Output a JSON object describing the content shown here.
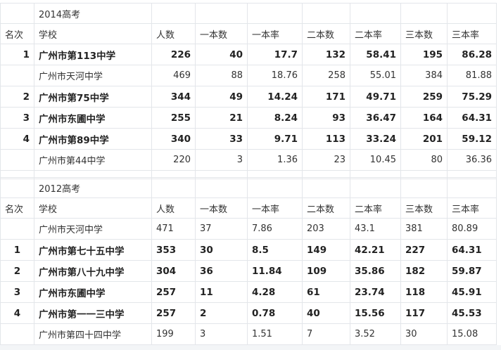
{
  "headers": [
    "名次",
    "学校",
    "人数",
    "一本数",
    "一本率",
    "二本数",
    "二本率",
    "三本数",
    "三本率"
  ],
  "section_2014": {
    "title": "2014高考",
    "rows": [
      {
        "rank": "1",
        "school": "广州市第113中学",
        "count": "226",
        "tier1": "40",
        "tier1_rate": "17.7",
        "tier2": "132",
        "tier2_rate": "58.41",
        "tier3": "195",
        "tier3_rate": "86.28",
        "bold": true
      },
      {
        "rank": "",
        "school": "广州市天河中学",
        "count": "469",
        "tier1": "88",
        "tier1_rate": "18.76",
        "tier2": "258",
        "tier2_rate": "55.01",
        "tier3": "384",
        "tier3_rate": "81.88",
        "bold": false
      },
      {
        "rank": "2",
        "school": "广州市第75中学",
        "count": "344",
        "tier1": "49",
        "tier1_rate": "14.24",
        "tier2": "171",
        "tier2_rate": "49.71",
        "tier3": "259",
        "tier3_rate": "75.29",
        "bold": true
      },
      {
        "rank": "3",
        "school": "广州市东圃中学",
        "count": "255",
        "tier1": "21",
        "tier1_rate": "8.24",
        "tier2": "93",
        "tier2_rate": "36.47",
        "tier3": "164",
        "tier3_rate": "64.31",
        "bold": true
      },
      {
        "rank": "4",
        "school": "广州市第89中学",
        "count": "340",
        "tier1": "33",
        "tier1_rate": "9.71",
        "tier2": "113",
        "tier2_rate": "33.24",
        "tier3": "201",
        "tier3_rate": "59.12",
        "bold": true
      },
      {
        "rank": "",
        "school": "广州市第44中学",
        "count": "220",
        "tier1": "3",
        "tier1_rate": "1.36",
        "tier2": "23",
        "tier2_rate": "10.45",
        "tier3": "80",
        "tier3_rate": "36.36",
        "bold": false
      }
    ]
  },
  "section_2012": {
    "title": "2012高考",
    "rows": [
      {
        "rank": "",
        "school": "广州市天河中学",
        "count": "471",
        "tier1": "37",
        "tier1_rate": "7.86",
        "tier2": "203",
        "tier2_rate": "43.1",
        "tier3": "381",
        "tier3_rate": "80.89",
        "bold": false
      },
      {
        "rank": "1",
        "school": "广州市第七十五中学",
        "count": "353",
        "tier1": "30",
        "tier1_rate": "8.5",
        "tier2": "149",
        "tier2_rate": "42.21",
        "tier3": "227",
        "tier3_rate": "64.31",
        "bold": true
      },
      {
        "rank": "2",
        "school": "广州市第八十九中学",
        "count": "304",
        "tier1": "36",
        "tier1_rate": "11.84",
        "tier2": "109",
        "tier2_rate": "35.86",
        "tier3": "182",
        "tier3_rate": "59.87",
        "bold": true
      },
      {
        "rank": "3",
        "school": "广州市东圃中学",
        "count": "257",
        "tier1": "11",
        "tier1_rate": "4.28",
        "tier2": "61",
        "tier2_rate": "23.74",
        "tier3": "118",
        "tier3_rate": "45.91",
        "bold": true
      },
      {
        "rank": "4",
        "school": "广州市第一一三中学",
        "count": "257",
        "tier1": "2",
        "tier1_rate": "0.78",
        "tier2": "40",
        "tier2_rate": "15.56",
        "tier3": "117",
        "tier3_rate": "45.53",
        "bold": true
      },
      {
        "rank": "",
        "school": "广州市第四十四中学",
        "count": "199",
        "tier1": "3",
        "tier1_rate": "1.51",
        "tier2": "7",
        "tier2_rate": "3.52",
        "tier3": "30",
        "tier3_rate": "15.08",
        "bold": false
      }
    ]
  }
}
